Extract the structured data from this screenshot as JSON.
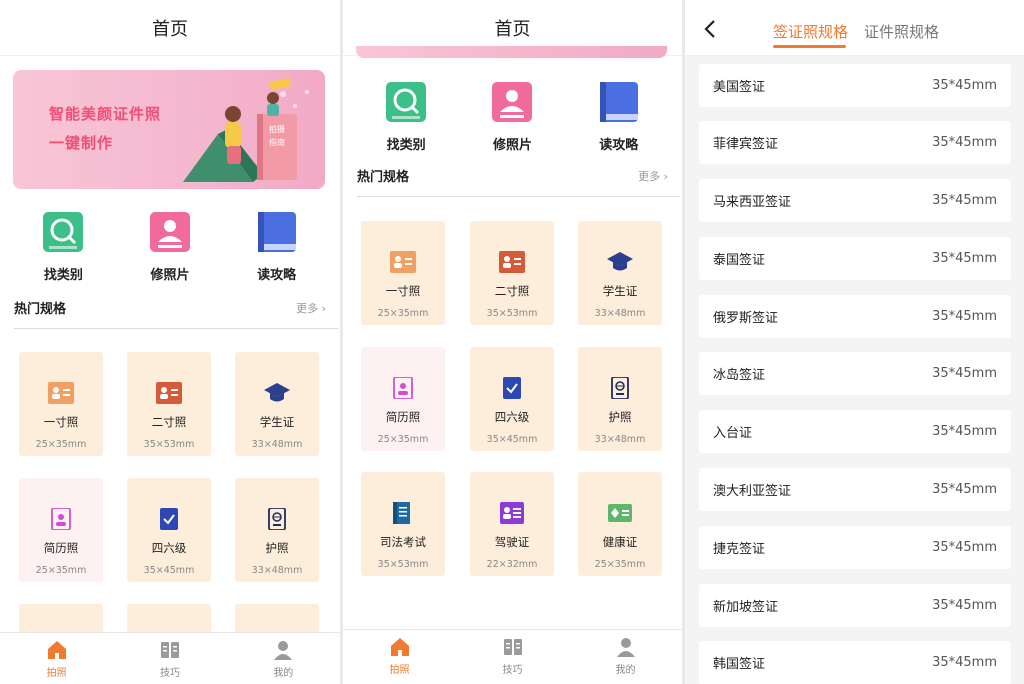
{
  "home": {
    "title": "首页",
    "banner": {
      "line1": "智能美颜证件照",
      "line2": "一键制作",
      "book_text1": "拍摄",
      "book_text2": "指南"
    },
    "categories": [
      {
        "label": "找类别",
        "icon": "search-doc-icon",
        "color": "#3dbf8a"
      },
      {
        "label": "修照片",
        "icon": "person-doc-icon",
        "color": "#f06a9c"
      },
      {
        "label": "读攻略",
        "icon": "book-icon",
        "color": "#4b6fe0"
      }
    ],
    "section_title": "热门规格",
    "more_label": "更多",
    "specs": [
      {
        "name": "一寸照",
        "size": "25×35mm",
        "icon": "id-card-icon"
      },
      {
        "name": "二寸照",
        "size": "35×53mm",
        "icon": "id-card-icon"
      },
      {
        "name": "学生证",
        "size": "33×48mm",
        "icon": "graduation-cap-icon"
      },
      {
        "name": "简历照",
        "size": "25×35mm",
        "icon": "resume-icon"
      },
      {
        "name": "四六级",
        "size": "35×45mm",
        "icon": "exam-icon"
      },
      {
        "name": "护照",
        "size": "33×48mm",
        "icon": "passport-icon"
      },
      {
        "name": "司法考试",
        "size": "35×53mm",
        "icon": "law-book-icon"
      },
      {
        "name": "驾驶证",
        "size": "22×32mm",
        "icon": "driver-license-icon"
      },
      {
        "name": "健康证",
        "size": "25×35mm",
        "icon": "health-card-icon"
      }
    ],
    "tabs": [
      {
        "label": "拍照",
        "icon": "home-icon",
        "active": true
      },
      {
        "label": "技巧",
        "icon": "book-open-icon",
        "active": false
      },
      {
        "label": "我的",
        "icon": "user-icon",
        "active": false
      }
    ]
  },
  "visa": {
    "tabs": [
      {
        "label": "签证照规格",
        "active": true
      },
      {
        "label": "证件照规格",
        "active": false
      }
    ],
    "items": [
      {
        "name": "美国签证",
        "size": "35*45mm"
      },
      {
        "name": "菲律宾签证",
        "size": "35*45mm"
      },
      {
        "name": "马来西亚签证",
        "size": "35*45mm"
      },
      {
        "name": "泰国签证",
        "size": "35*45mm"
      },
      {
        "name": "俄罗斯签证",
        "size": "35*45mm"
      },
      {
        "name": "冰岛签证",
        "size": "35*45mm"
      },
      {
        "name": "入台证",
        "size": "35*45mm"
      },
      {
        "name": "澳大利亚签证",
        "size": "35*45mm"
      },
      {
        "name": "捷克签证",
        "size": "35*45mm"
      },
      {
        "name": "新加坡签证",
        "size": "35*45mm"
      },
      {
        "name": "韩国签证",
        "size": "35*45mm"
      }
    ]
  },
  "colors": {
    "accent": "#f07a2e",
    "card_bg": "#fdeedb",
    "card_pink_bg": "#fdf1f1",
    "banner_pink": "#f4b7cf",
    "banner_text": "#ef4f74"
  }
}
